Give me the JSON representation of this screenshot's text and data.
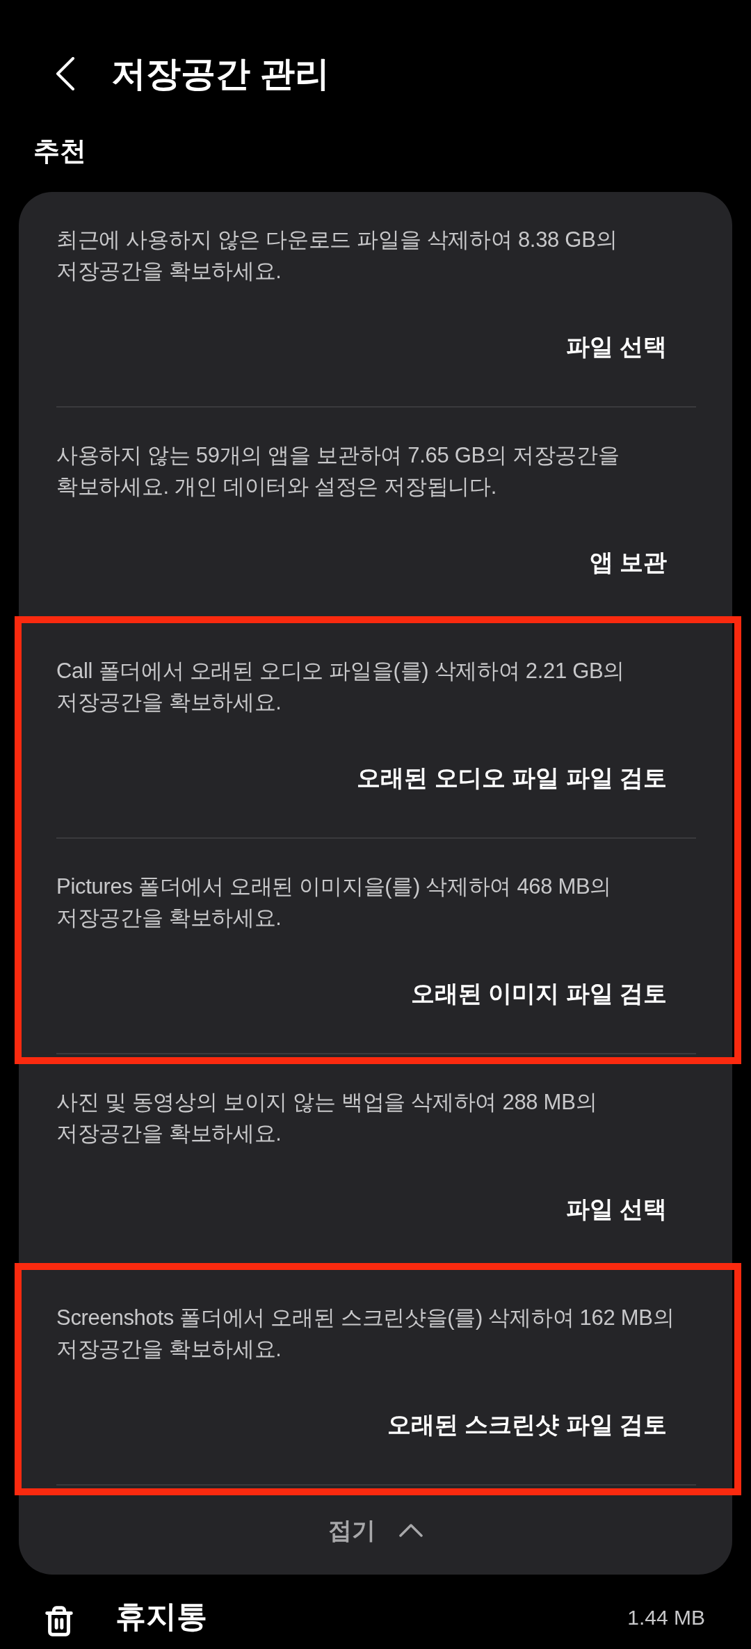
{
  "header": {
    "title": "저장공간 관리"
  },
  "recommendations": {
    "heading": "추천",
    "groups": [
      {
        "highlighted": false,
        "items": [
          {
            "description": "최근에 사용하지 않은 다운로드 파일을 삭제하여 8.38 GB의 저장공간을 확보하세요.",
            "action": "파일 선택"
          },
          {
            "description": "사용하지 않는 59개의 앱을 보관하여 7.65 GB의 저장공간을 확보하세요. 개인 데이터와 설정은 저장됩니다.",
            "action": "앱 보관"
          }
        ]
      },
      {
        "highlighted": true,
        "items": [
          {
            "description": "Call 폴더에서 오래된 오디오 파일을(를) 삭제하여 2.21 GB의 저장공간을 확보하세요.",
            "action": "오래된 오디오 파일 파일 검토"
          },
          {
            "description": "Pictures 폴더에서 오래된 이미지을(를) 삭제하여 468 MB의 저장공간을 확보하세요.",
            "action": "오래된 이미지 파일 검토"
          }
        ]
      },
      {
        "highlighted": false,
        "items": [
          {
            "description": "사진 및 동영상의 보이지 않는 백업을 삭제하여 288 MB의 저장공간을 확보하세요.",
            "action": "파일 선택"
          }
        ]
      },
      {
        "highlighted": true,
        "items": [
          {
            "description": "Screenshots 폴더에서 오래된 스크린샷을(를) 삭제하여 162 MB의 저장공간을 확보하세요.",
            "action": "오래된 스크린샷 파일 검토"
          }
        ]
      }
    ],
    "collapse": {
      "label": "접기",
      "expanded": true
    }
  },
  "storage_items": [
    {
      "label": "휴지통",
      "size": "1.44 MB"
    }
  ]
}
